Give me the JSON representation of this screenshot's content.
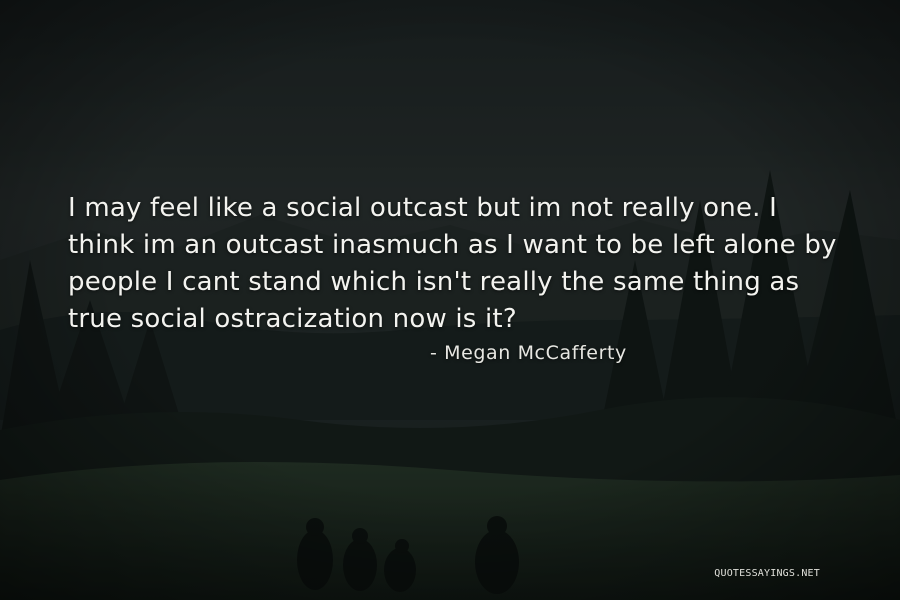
{
  "quote": {
    "text": "I may feel like a social outcast but im not really one. I think im an outcast inasmuch as I want to be left alone by people I cant stand which isn't really the same thing as true social ostracization now is it?",
    "author": "- Megan McCafferty"
  },
  "watermark": {
    "text": "QUOTESSAYINGS.NET"
  },
  "colors": {
    "sky": "#2a3231",
    "forest": "#1a2321",
    "meadow": "#233327",
    "text": "#f3f3ef"
  }
}
